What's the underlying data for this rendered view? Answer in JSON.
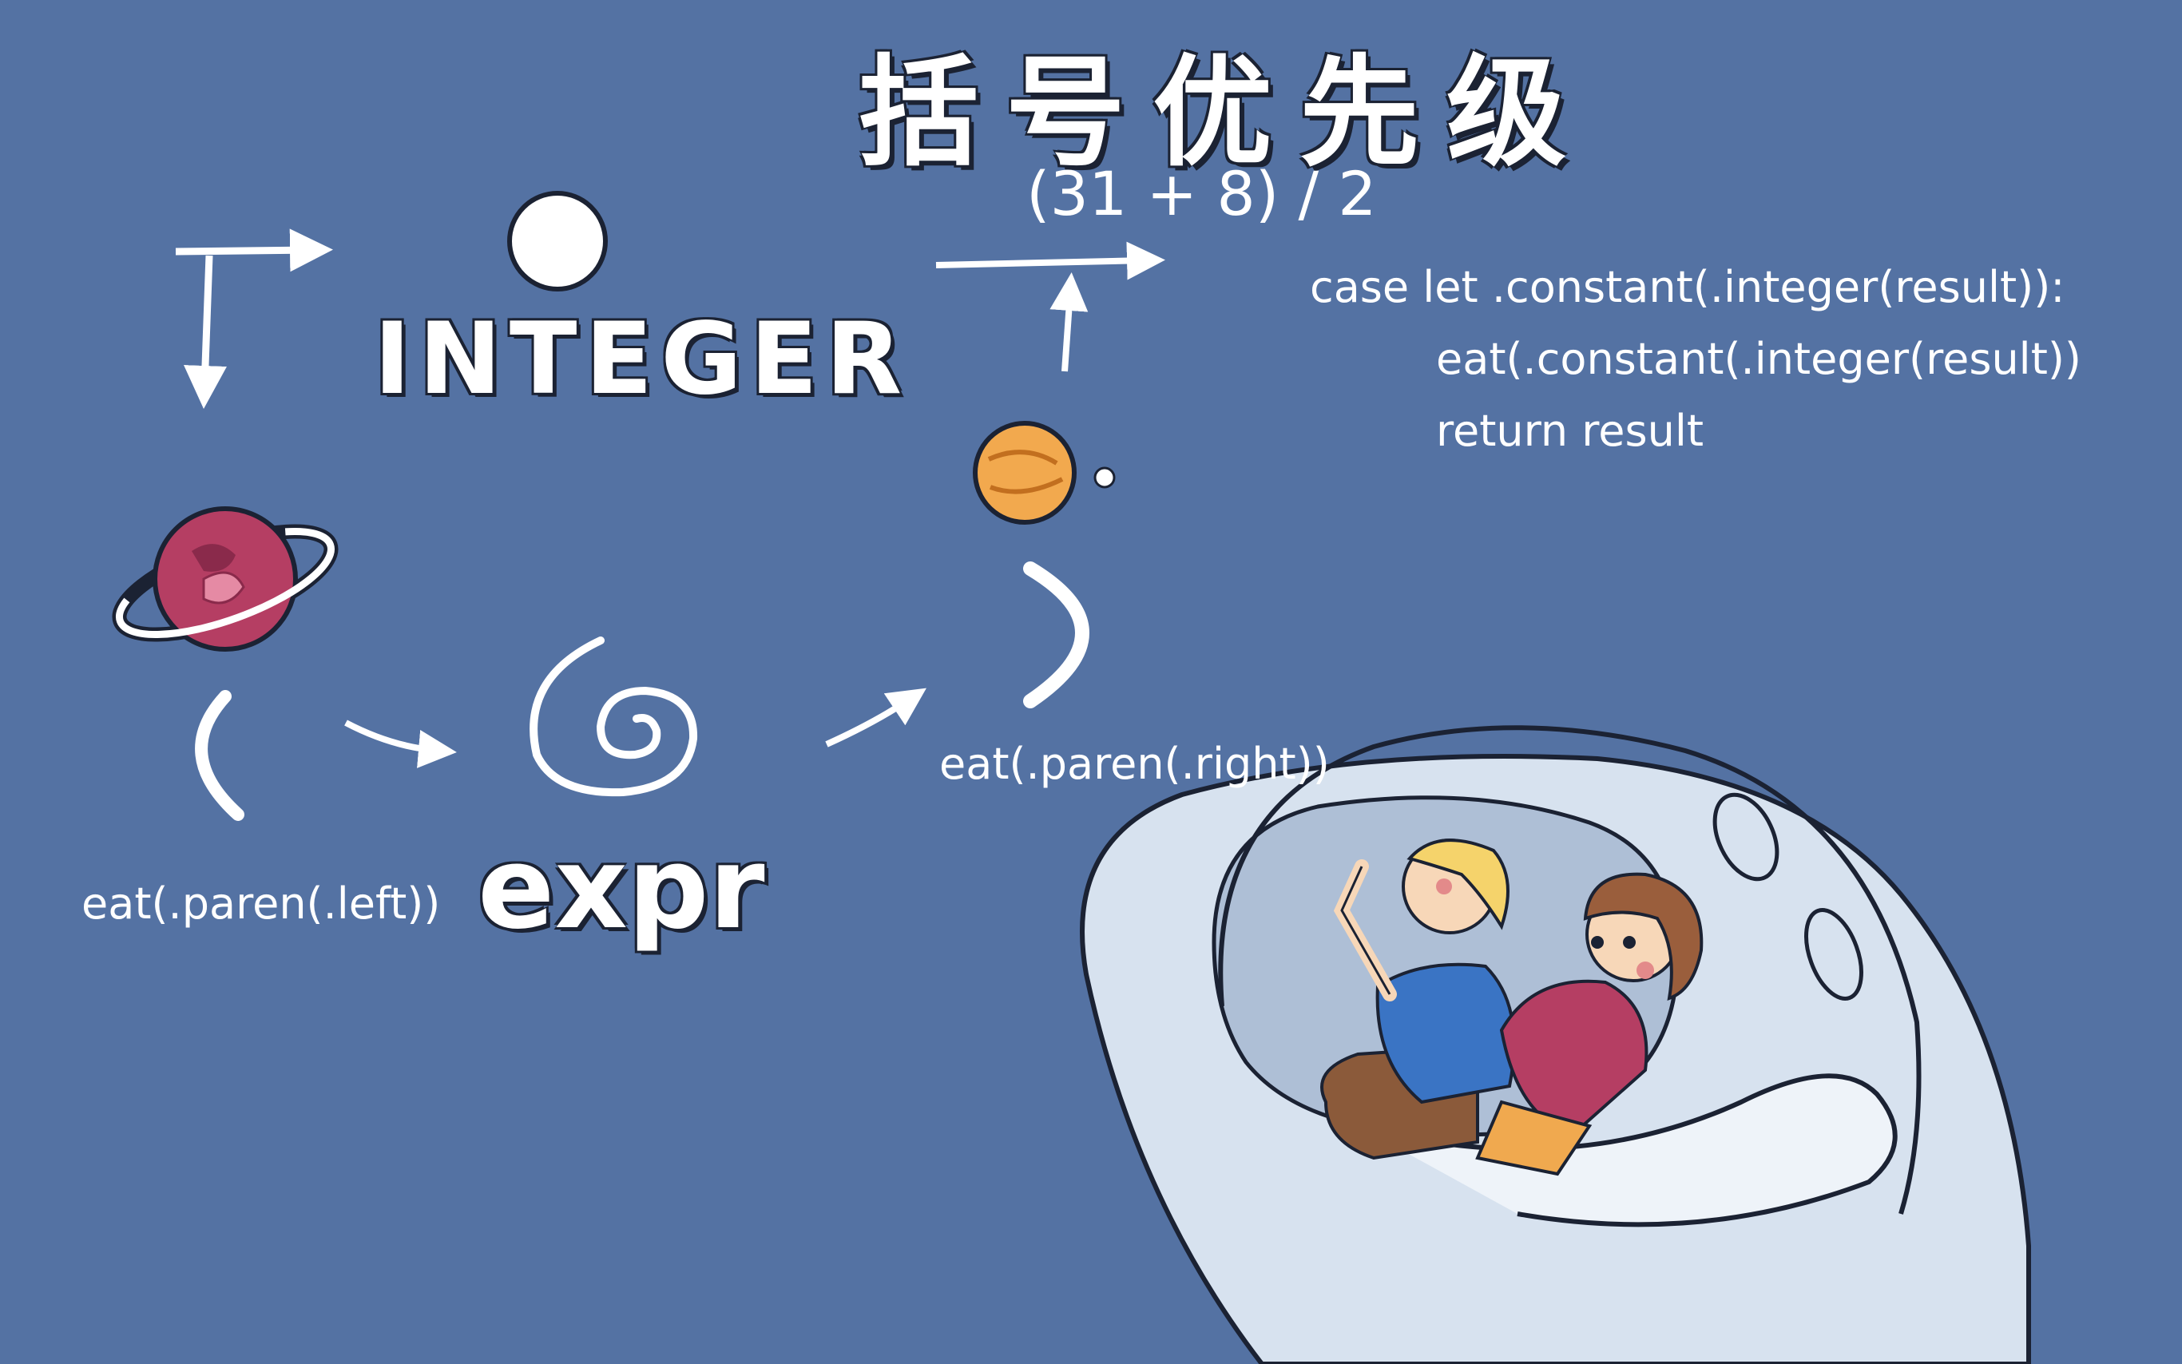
{
  "title": "括号优先级",
  "formula": "(31 + 8) / 2",
  "nodes": {
    "integer": "INTEGER",
    "expr": "expr"
  },
  "code_lines": [
    "case let .constant(.integer(result)):",
    "eat(.constant(.integer(result))",
    "return result"
  ],
  "calls": {
    "eat_left": "eat(.paren(.left))",
    "eat_right": "eat(.paren(.right))"
  },
  "icons": {
    "dot": "white-circle-icon",
    "left_paren_planet": "ringed-planet-icon",
    "expr_symbol": "spiral-galaxy-icon",
    "right_paren_planet": "orange-planet-icon",
    "ufo": "ufo-with-kids-illustration"
  },
  "colors": {
    "background": "#5472a3",
    "ringed_planet": "#b53e63",
    "orange_planet": "#f2a94e",
    "ufo_body": "#d7e2ef",
    "boy_shirt": "#3a74c4",
    "girl_shirt": "#b53e63"
  }
}
